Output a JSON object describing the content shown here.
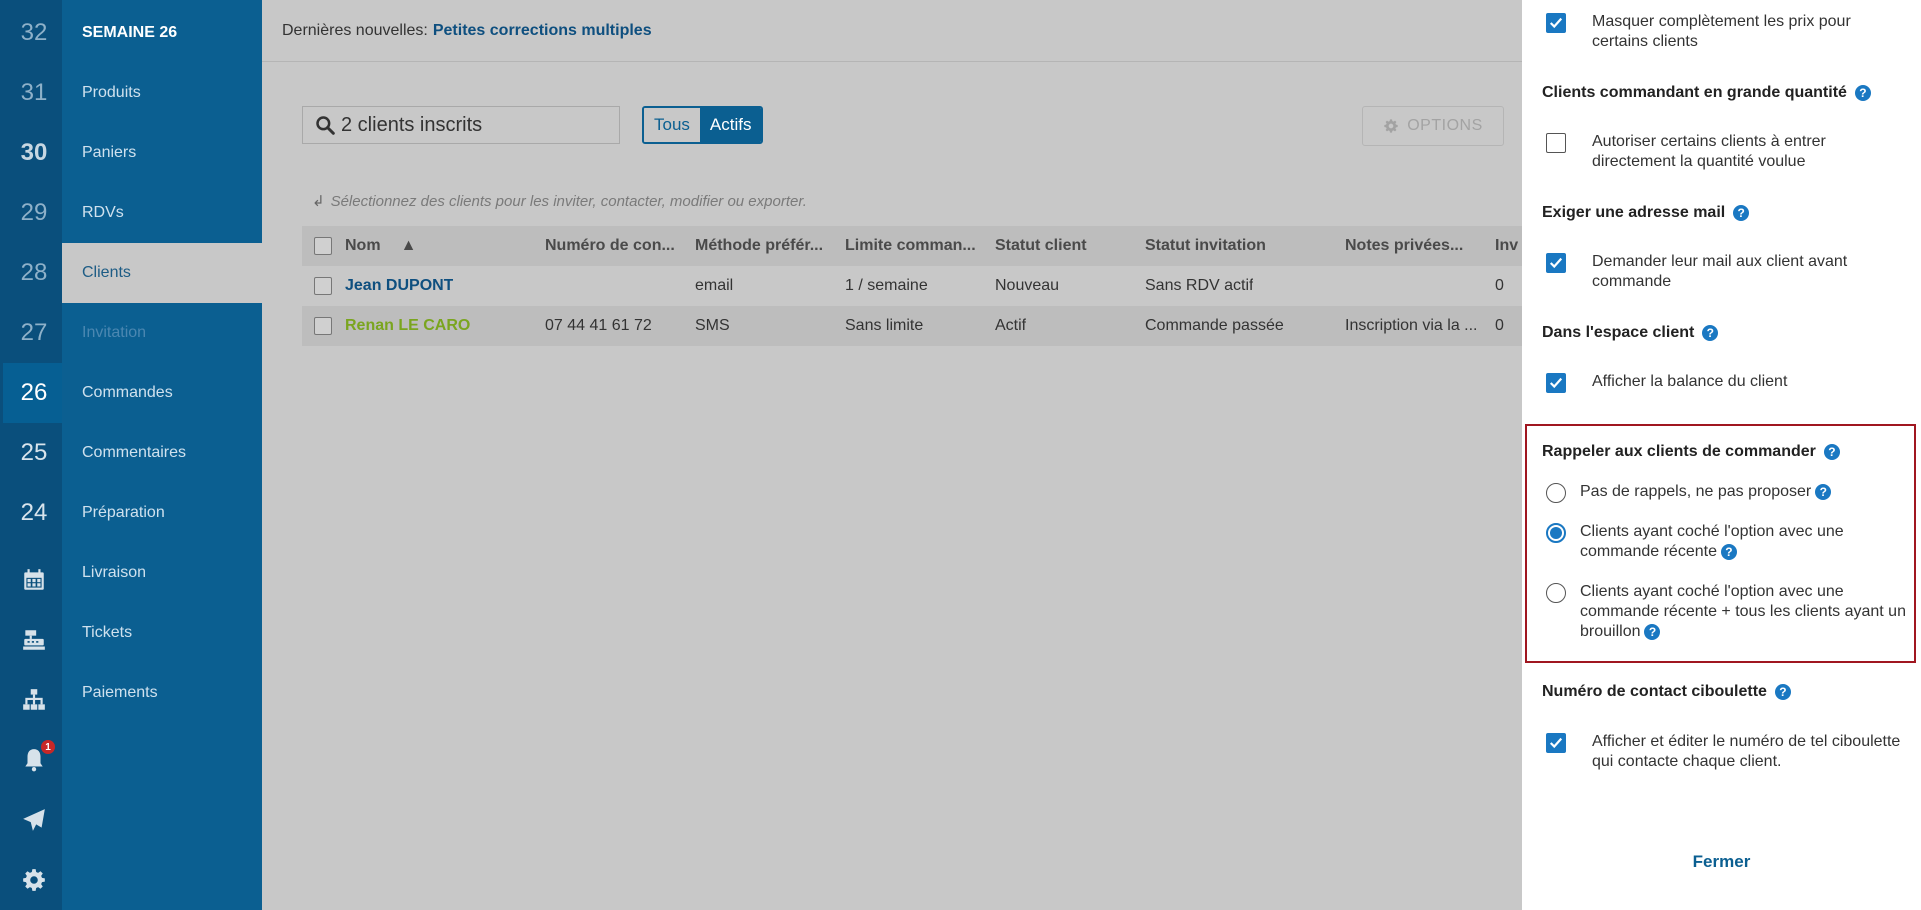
{
  "weeks": {
    "numbers": [
      "32",
      "31",
      "30",
      "29",
      "28",
      "27",
      "26",
      "25",
      "24"
    ],
    "notifications_badge": "1"
  },
  "sidebar": {
    "title": "SEMAINE 26",
    "items": [
      "Produits",
      "Paniers",
      "RDVs",
      "Clients",
      "Invitation",
      "Commandes",
      "Commentaires",
      "Préparation",
      "Livraison",
      "Tickets",
      "Paiements"
    ]
  },
  "news": {
    "prefix": "Dernières nouvelles:",
    "link": "Petites corrections multiples"
  },
  "search": {
    "value": "2 clients inscrits"
  },
  "filter": {
    "all": "Tous",
    "active": "Actifs"
  },
  "options_button": "OPTIONS",
  "hint": "Sélectionnez des clients pour les inviter, contacter, modifier ou exporter.",
  "table": {
    "headers": [
      "Nom",
      "Numéro de con...",
      "Méthode préfér...",
      "Limite comman...",
      "Statut client",
      "Statut invitation",
      "Notes privées...",
      "Inv"
    ],
    "sort_indicator": "▲",
    "rows": [
      [
        "Jean DUPONT",
        "",
        "email",
        "1 / semaine",
        "Nouveau",
        "Sans RDV actif",
        "",
        "0"
      ],
      [
        "Renan LE CARO",
        "07 44 41 61 72",
        "SMS",
        "Sans limite",
        "Actif",
        "Commande passée",
        "Inscription via la ...",
        "0"
      ]
    ]
  },
  "panel": {
    "opt_hide_prices": "Masquer complètement les prix pour certains clients",
    "sec_bulk": "Clients commandant en grande quantité",
    "opt_bulk": "Autoriser certains clients à entrer directement la quantité voulue",
    "sec_email": "Exiger une adresse mail",
    "opt_email": "Demander leur mail aux client avant commande",
    "sec_space": "Dans l'espace client",
    "opt_balance": "Afficher la balance du client",
    "sec_remind": "Rappeler aux clients de commander",
    "radio_none": "Pas de rappels, ne pas proposer",
    "radio_recent": "Clients ayant coché l'option avec une commande récente",
    "radio_recent_draft": "Clients ayant coché l'option avec une commande récente + tous les clients ayant un brouillon",
    "sec_contact": "Numéro de contact ciboulette",
    "opt_contact": "Afficher et éditer le numéro de tel ciboulette qui contacte chaque client.",
    "help": "?",
    "close": "Fermer"
  }
}
